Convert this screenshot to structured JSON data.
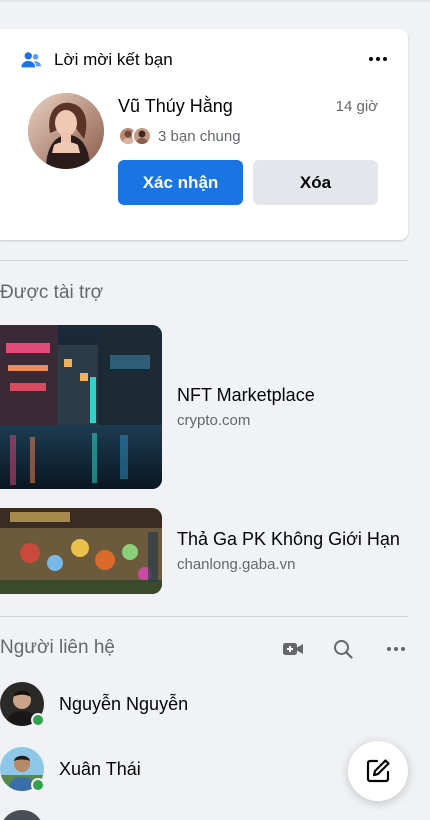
{
  "friend_requests": {
    "title": "Lời mời kết bạn",
    "request": {
      "name": "Vũ Thúy Hằng",
      "time": "14 giờ",
      "mutual": "3 bạn chung",
      "confirm_label": "Xác nhận",
      "delete_label": "Xóa"
    }
  },
  "sponsored": {
    "title": "Được tài trợ",
    "ads": [
      {
        "title": "NFT Marketplace",
        "domain": "crypto.com"
      },
      {
        "title": "Thả Ga PK Không Giới Hạn",
        "domain": "chanlong.gaba.vn"
      }
    ]
  },
  "contacts": {
    "title": "Người liên hệ",
    "items": [
      {
        "name": "Nguyễn Nguyễn",
        "online": true
      },
      {
        "name": "Xuân Thái",
        "online": true
      }
    ]
  },
  "icons": {
    "friend_requests": "people-icon",
    "more": "more-horizontal-icon",
    "video_call": "video-camera-plus-icon",
    "search": "search-icon",
    "new_message": "compose-icon"
  },
  "colors": {
    "primary": "#1b74e4",
    "online": "#31a24c",
    "secondary_text": "#65676b",
    "background": "#f0f2f5"
  }
}
